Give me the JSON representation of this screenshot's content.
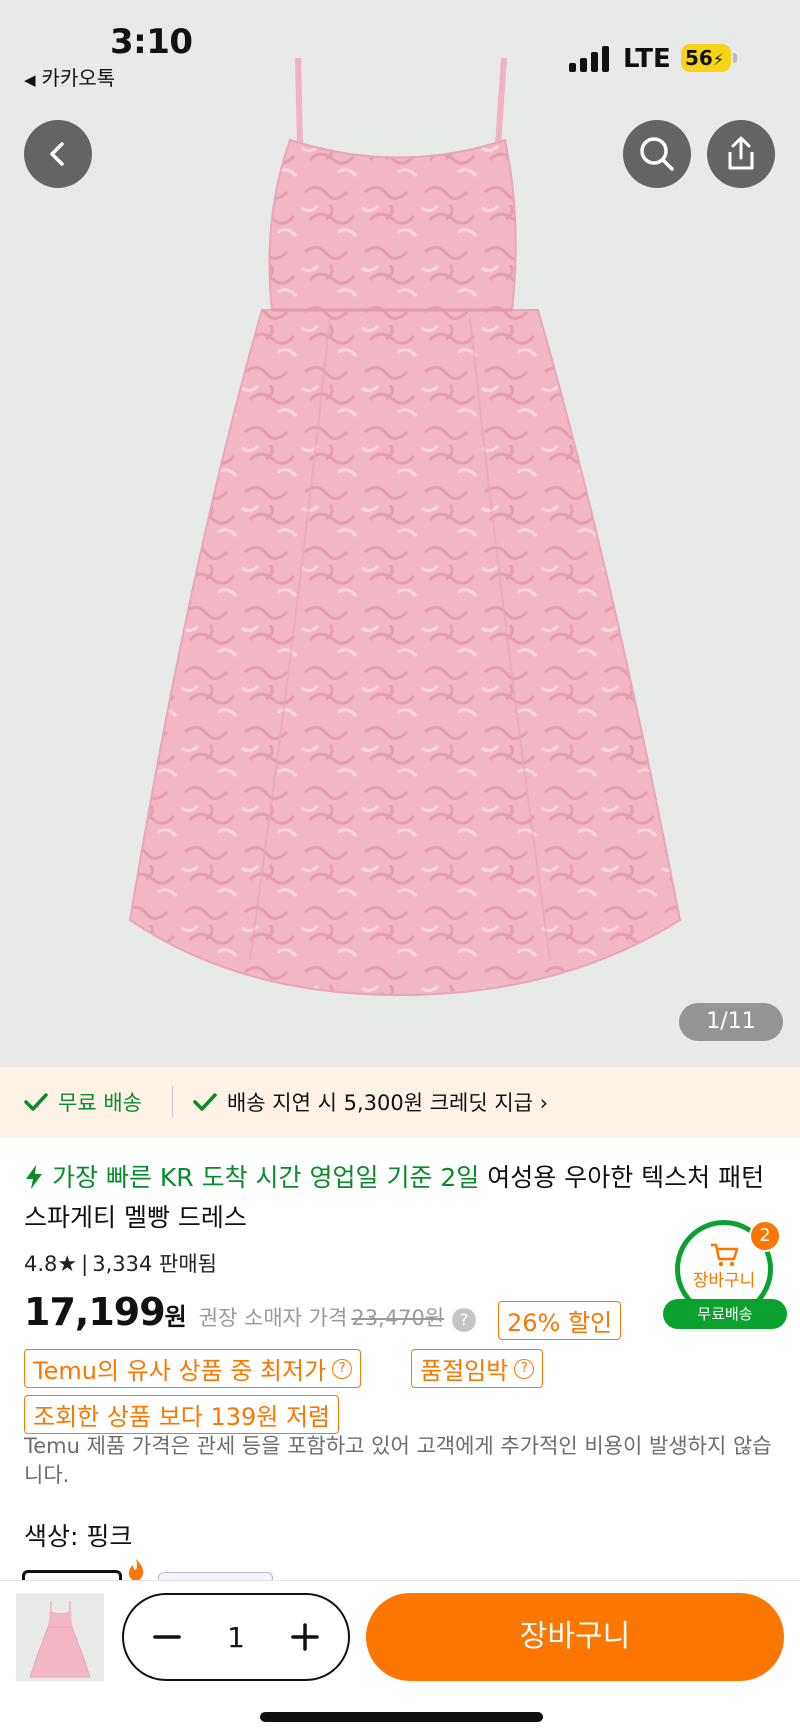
{
  "status_bar": {
    "time": "3:10",
    "back_app": "카카오톡",
    "network": "LTE",
    "battery": "56"
  },
  "hero": {
    "image_counter": "1/11"
  },
  "shipping_banner": {
    "free_shipping": "무료 배송",
    "delay_credit": "배송 지연 시 5,300원 크레딧 지급 ›"
  },
  "product": {
    "fast_delivery": "가장 빠른 KR 도착 시간 영업일 기준 2일",
    "title": "여성용 우아한 텍스처 패턴 스파게티 멜빵 드레스",
    "rating": "4.8",
    "sold": "3,334 판매됨",
    "price": "17,199",
    "price_unit": "원",
    "msrp_label": "권장 소매자 가격",
    "msrp": "23,470원",
    "discount_tag": "26% 할인",
    "lowest_tag": "Temu의 유사 상품 중 최저가",
    "soldout_tag": "품절임박",
    "cheaper_tag": "조회한 상품 보다 139원 저렴",
    "notice": "Temu 제품 가격은 관세 등을 포함하고 있어 고객에게 추가적인 비용이 발생하지 않습니다.",
    "color_label": "색상: 핑크"
  },
  "floating_cart": {
    "label": "장바구니",
    "count": "2",
    "free_shipping": "무료배송"
  },
  "bottom_bar": {
    "quantity": "1",
    "add_to_cart": "장바구니"
  },
  "colors": {
    "accent_orange": "#fb7701",
    "green": "#0a8a2a",
    "dress_pink": "#f2b6c4"
  }
}
